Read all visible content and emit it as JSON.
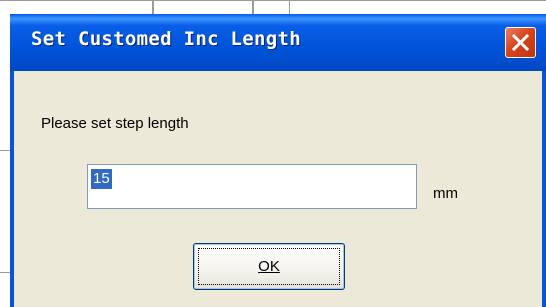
{
  "dialog": {
    "title": "Set Customed Inc Length",
    "prompt": "Please set step length",
    "input_value": "15",
    "unit": "mm",
    "ok_label": "OK"
  },
  "colors": {
    "titlebar": "#0053d8",
    "client_bg": "#ece9d8",
    "close_button": "#d9441c",
    "selection": "#316ac5"
  }
}
